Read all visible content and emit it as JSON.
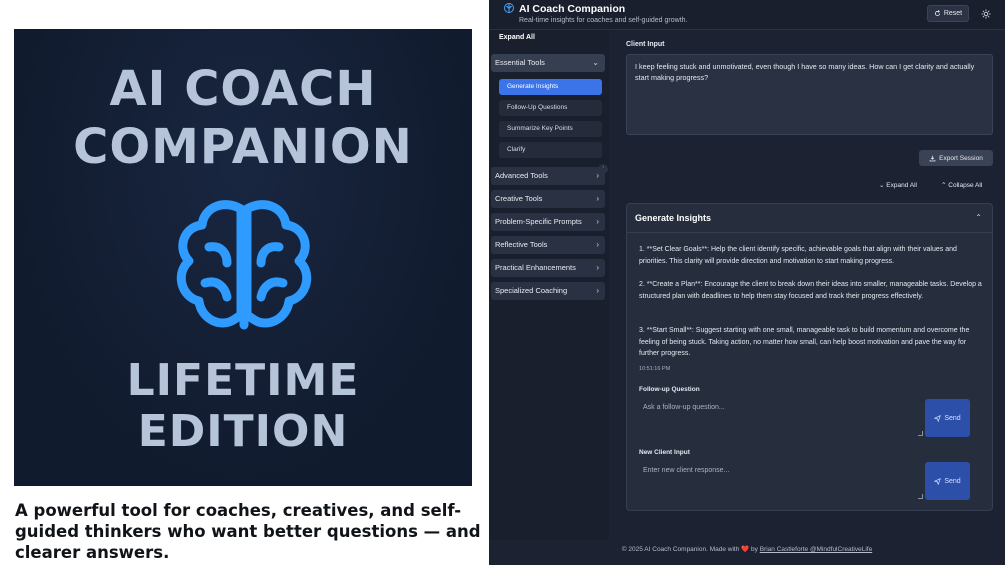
{
  "promo": {
    "title_line1": "AI COACH",
    "title_line2": "COMPANION",
    "edition_line1": "LIFETIME",
    "edition_line2": "EDITION",
    "tagline": "A powerful tool for coaches, creatives, and self-guided thinkers who want better questions — and clearer answers.",
    "icon": "brain-icon",
    "brain_color": "#2f9bff"
  },
  "app": {
    "title": "AI Coach Companion",
    "subtitle": "Real-time insights for coaches and self-guided growth.",
    "reset_label": "Reset",
    "theme_icon": "sun-icon"
  },
  "sidebar": {
    "expand_all": "Expand All",
    "groups": [
      {
        "label": "Essential Tools",
        "expanded": true
      },
      {
        "label": "Advanced Tools"
      },
      {
        "label": "Creative Tools"
      },
      {
        "label": "Problem-Specific Prompts"
      },
      {
        "label": "Reflective Tools"
      },
      {
        "label": "Practical Enhancements"
      },
      {
        "label": "Specialized Coaching"
      }
    ],
    "essential_items": [
      {
        "label": "Generate Insights",
        "selected": true
      },
      {
        "label": "Follow-Up Questions"
      },
      {
        "label": "Summarize Key Points"
      },
      {
        "label": "Clarify"
      }
    ]
  },
  "main": {
    "client_input_label": "Client Input",
    "client_input_value": "I keep feeling stuck and unmotivated, even though I have so many ideas. How can I get clarity and actually start making progress?",
    "export_label": "Export Session",
    "expand_all": "Expand All",
    "collapse_all": "Collapse All",
    "insights": {
      "title": "Generate Insights",
      "paragraphs": [
        "1. **Set Clear Goals**: Help the client identify specific, achievable goals that align with their values and priorities. This clarity will provide direction and motivation to start making progress.",
        "2. **Create a Plan**: Encourage the client to break down their ideas into smaller, manageable tasks. Develop a structured plan with deadlines to help them stay focused and track their progress effectively.",
        "3. **Start Small**: Suggest starting with one small, manageable task to build momentum and overcome the feeling of being stuck. Taking action, no matter how small, can help boost motivation and pave the way for further progress."
      ],
      "timestamp": "10:51:16 PM",
      "followup_label": "Follow-up Question",
      "followup_placeholder": "Ask a follow-up question...",
      "new_input_label": "New Client Input",
      "new_input_placeholder": "Enter new client response...",
      "send_label": "Send"
    }
  },
  "footer": {
    "prefix": "© 2025 AI Coach Companion. Made with",
    "heart": "❤️",
    "by": "by",
    "author": "Brian Castleforte @MindfulCreativeLife"
  },
  "colors": {
    "accent": "#3b74e8",
    "send_button": "#2c4faa",
    "app_bg": "#1c2232"
  }
}
